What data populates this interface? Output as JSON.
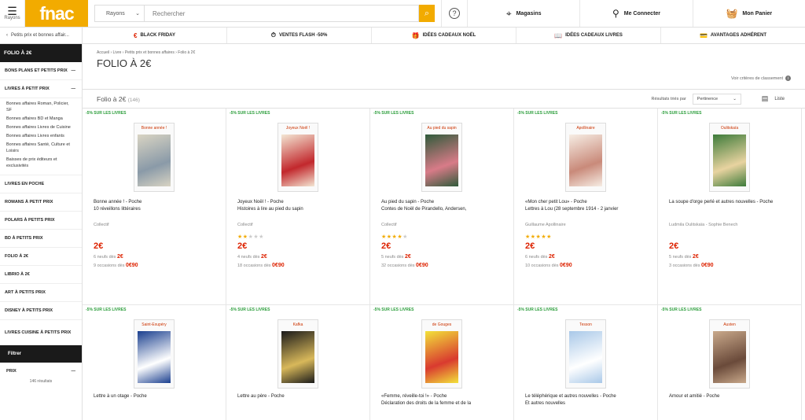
{
  "header": {
    "menu_label": "Rayons",
    "logo": "fnac",
    "category_select": "Rayons",
    "search_placeholder": "Rechercher",
    "stores": "Magasins",
    "login": "Me Connecter",
    "cart": "Mon Panier"
  },
  "subnav": {
    "back": "Petits prix et bonnes affair...",
    "promos": [
      "BLACK FRIDAY",
      "VENTES FLASH -50%",
      "IDÉES CADEAUX NOËL",
      "IDÉES CADEAUX LIVRES",
      "AVANTAGES ADHÉRENT"
    ]
  },
  "sidebar": {
    "current": "FOLIO À 2€",
    "bons_plans": "BONS PLANS ET PETITS PRIX",
    "livres_petit_prix": "LIVRES À PETIT PRIX",
    "sub_items": [
      "Bonnes affaires Roman, Policier, SF",
      "Bonnes affaires BD et Manga",
      "Bonnes affaires Livres de Cuisine",
      "Bonnes affaires Livres enfants",
      "Bonnes affaires Santé, Culture et Loisirs",
      "Baisses de prix éditeurs et exclusivités"
    ],
    "items": [
      "LIVRES EN POCHE",
      "ROMANS À PETIT PRIX",
      "POLARS À PETITS PRIX",
      "BD À PETITS PRIX",
      "FOLIO À 2€",
      "LIBRIO À 2€",
      "ART À PETITS PRIX",
      "DISNEY À PETITS PRIX",
      "LIVRES CUISINE À PETITS PRIX"
    ],
    "filter": "Filtrer",
    "price": "PRIX",
    "results": "146 résultats"
  },
  "main": {
    "breadcrumb": "Accueil › Livre › Petits prix et bonnes affaires › Folio à 2€",
    "title": "FOLIO À 2€",
    "criteria": "Voir critères de classement",
    "list_title": "Folio à 2€",
    "list_count": "(146)",
    "sort_label": "Résultats triés par",
    "sort_value": "Pertinence",
    "view_label": "Liste"
  },
  "products": [
    {
      "tag": "-5% SUR LES LIVRES",
      "cover_title": "Bonne année !",
      "name": "Bonne année ! - Poche\n10 réveillons littéraires",
      "author": "Collectif",
      "rating": 0,
      "price": "2€",
      "new_text": "6 neufs  dès",
      "new_price": "2€",
      "used_text": "9 occasions  dès",
      "used_price": "0€90",
      "colors": [
        "#d9d4c3",
        "#8a9aa8"
      ]
    },
    {
      "tag": "-5% SUR LES LIVRES",
      "cover_title": "Joyeux Noël !",
      "name": "Joyeux Noël ! - Poche\nHistoires à lire au pied du sapin",
      "author": "Collectif",
      "rating": 2,
      "price": "2€",
      "new_text": "4 neufs  dès",
      "new_price": "2€",
      "used_text": "18 occasions  dès",
      "used_price": "0€90",
      "colors": [
        "#f3e6d3",
        "#c2282d"
      ]
    },
    {
      "tag": "-5% SUR LES LIVRES",
      "cover_title": "Au pied du sapin",
      "name": "Au pied du sapin - Poche\nContes de Noël de Pirandello, Andersen,",
      "author": "Collectif",
      "rating": 4,
      "price": "2€",
      "new_text": "5 neufs  dès",
      "new_price": "2€",
      "used_text": "32 occasions  dès",
      "used_price": "0€90",
      "colors": [
        "#2f5a3a",
        "#d87b88"
      ]
    },
    {
      "tag": "-5% SUR LES LIVRES",
      "cover_title": "Apollinaire",
      "name": "«Mon cher petit Lou» - Poche\nLettres à Lou (28 septembre 1914 - 2 janvier",
      "author": "Guillaume Apollinaire",
      "rating": 5,
      "price": "2€",
      "new_text": "6 neufs  dès",
      "new_price": "2€",
      "used_text": "10 occasions  dès",
      "used_price": "0€90",
      "colors": [
        "#f6ede4",
        "#c98a7a"
      ]
    },
    {
      "tag": "-5% SUR LES LIVRES",
      "cover_title": "Oulitskaïa",
      "name": "La soupe d'orge perlé et autres nouvelles - Poche",
      "author": "Ludmila Oulitskaïa - Sophie Benech",
      "rating": 0,
      "price": "2€",
      "new_text": "5 neufs  dès",
      "new_price": "2€",
      "used_text": "3 occasions  dès",
      "used_price": "0€90",
      "colors": [
        "#3d7b3a",
        "#e8d3a0"
      ]
    },
    {
      "tag": "-5% SUR LES LIVRES",
      "cover_title": "Saint-Exupéry",
      "name": "Lettre à un otage - Poche",
      "colors": [
        "#1a3f8f",
        "#ffffff"
      ]
    },
    {
      "tag": "-5% SUR LES LIVRES",
      "cover_title": "Kafka",
      "name": "Lettre au père - Poche",
      "colors": [
        "#1a1a1a",
        "#d8b85a"
      ]
    },
    {
      "tag": "-5% SUR LES LIVRES",
      "cover_title": "de Gouges",
      "name": "«Femme, réveille-toi !» - Poche\nDéclaration des droits de la femme et de la",
      "colors": [
        "#f2e23a",
        "#d93a2f"
      ]
    },
    {
      "tag": "-5% SUR LES LIVRES",
      "cover_title": "Tesson",
      "name": "Le téléphérique et autres nouvelles - Poche\nEt autres nouvelles",
      "colors": [
        "#a9c8e8",
        "#ffffff"
      ]
    },
    {
      "tag": "-5% SUR LES LIVRES",
      "cover_title": "Austen",
      "name": "Amour et amitié - Poche",
      "colors": [
        "#c9a98b",
        "#6a4a3a"
      ]
    }
  ]
}
